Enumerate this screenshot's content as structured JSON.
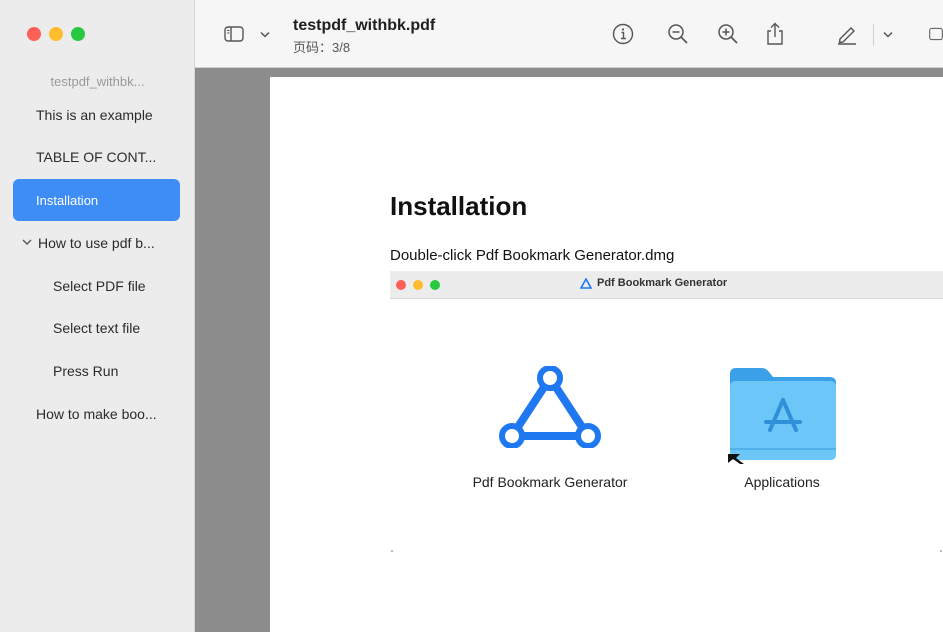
{
  "sidebar": {
    "title": "testpdf_withbk...",
    "items": [
      {
        "label": "This is an example"
      },
      {
        "label": "TABLE OF CONT..."
      },
      {
        "label": "Installation"
      },
      {
        "label": "How to use pdf b..."
      },
      {
        "label": "Select PDF file"
      },
      {
        "label": "Select text file"
      },
      {
        "label": "Press Run"
      },
      {
        "label": "How to make boo..."
      }
    ]
  },
  "toolbar": {
    "doc_title": "testpdf_withbk.pdf",
    "page_info": "页码：3/8"
  },
  "page": {
    "heading": "Installation",
    "instruction": "Double-click Pdf Bookmark Generator.dmg",
    "dmg_window": {
      "title": "Pdf Bookmark Generator",
      "app_label": "Pdf Bookmark Generator",
      "folder_label": "Applications"
    }
  },
  "colors": {
    "selection": "#3e8df7",
    "app_icon_blue": "#1f78f0",
    "folder_blue": "#5bbcf5"
  },
  "icons": [
    "sidebar-toggle-icon",
    "chevron-down-icon",
    "info-icon",
    "zoom-out-icon",
    "zoom-in-icon",
    "share-icon",
    "markup-pen-icon",
    "window-resize-icon"
  ]
}
